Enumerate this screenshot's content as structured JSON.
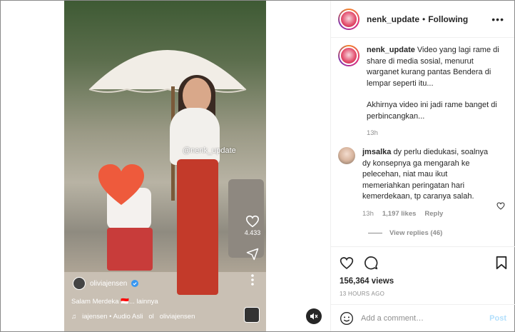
{
  "video": {
    "watermark": "@nenk_update",
    "like_count": "4.433",
    "username": "oliviajensen",
    "caption": "Salam Merdeka 🇮🇩... lainnya",
    "audio_prefix": "iajensen • Audio Asli",
    "audio_suffix": "ol",
    "audio_user": "oliviajensen"
  },
  "header": {
    "username": "nenk_update",
    "separator": "•",
    "follow_state": "Following",
    "more": "•••"
  },
  "post": {
    "author": "nenk_update",
    "caption_p1": "Video yang lagi rame di share di media sosial, menurut warganet kurang pantas Bendera di lempar seperti itu...",
    "caption_p2": "Akhirnya video ini jadi rame banget di perbincangkan...",
    "age": "13h"
  },
  "comment": {
    "user": "jmsalka",
    "text": "dy perlu diedukasi, soalnya dy konsepnya ga mengarah ke pelecehan, niat mau ikut memeriahkan peringatan hari kemerdekaan, tp caranya salah.",
    "age": "13h",
    "likes": "1,197 likes",
    "reply": "Reply",
    "view_replies": "View replies (46)"
  },
  "stats": {
    "views": "156,364 views",
    "posted": "13 HOURS AGO"
  },
  "add_comment": {
    "placeholder": "Add a comment…",
    "post_label": "Post"
  },
  "colors": {
    "accent_blue": "#b2dffc",
    "muted_gray": "#8e8e8e",
    "text": "#262626"
  }
}
